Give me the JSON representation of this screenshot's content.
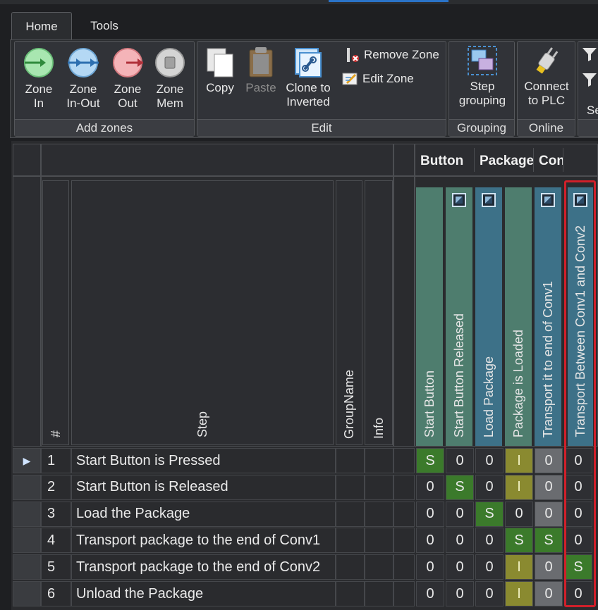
{
  "tabs": [
    {
      "label": "Home",
      "active": true
    },
    {
      "label": "Tools",
      "active": false
    }
  ],
  "ribbon": {
    "groups": [
      {
        "title": "Add zones",
        "buttons": [
          {
            "label": "Zone\nIn",
            "icon": "zone-in-icon"
          },
          {
            "label": "Zone\nIn-Out",
            "icon": "zone-in-out-icon"
          },
          {
            "label": "Zone\nOut",
            "icon": "zone-out-icon"
          },
          {
            "label": "Zone\nMem",
            "icon": "zone-mem-icon"
          }
        ]
      },
      {
        "title": "Edit",
        "buttons": [
          {
            "label": "Copy",
            "icon": "copy-icon"
          },
          {
            "label": "Paste",
            "icon": "paste-icon",
            "disabled": true
          },
          {
            "label": "Clone to\nInverted",
            "icon": "clone-icon"
          },
          {
            "label": "Remove Zone",
            "icon": "remove-zone-icon"
          },
          {
            "label": "Edit Zone",
            "icon": "edit-zone-icon"
          }
        ]
      },
      {
        "title": "Grouping",
        "buttons": [
          {
            "label": "Step\ngrouping",
            "icon": "step-grouping-icon"
          }
        ]
      },
      {
        "title": "Online",
        "buttons": [
          {
            "label": "Connect\nto PLC",
            "icon": "plug-icon"
          }
        ]
      },
      {
        "title": "",
        "buttons": [
          {
            "label": "Se",
            "icon": "filter-icon"
          }
        ]
      }
    ]
  },
  "grid": {
    "fixed_headers": {
      "number": "#",
      "step": "Step",
      "group": "GroupName",
      "info": "Info"
    },
    "column_groups": [
      "Button",
      "Package",
      "Con"
    ],
    "columns": [
      {
        "label": "Start Button",
        "color": "#4e7d6e",
        "icon": false
      },
      {
        "label": "Start Button Released",
        "color": "#4e7d6e",
        "icon": true
      },
      {
        "label": "Load Package",
        "color": "#3d7188",
        "icon": true
      },
      {
        "label": "Package is Loaded",
        "color": "#4e7d6e",
        "icon": false
      },
      {
        "label": "Transport it to end of Conv1",
        "color": "#3d7188",
        "icon": true
      },
      {
        "label": "Transport Between Conv1 and Conv2",
        "color": "#3d7188",
        "icon": true
      }
    ],
    "rows": [
      {
        "num": "1",
        "step": "Start Button is Pressed",
        "current": true,
        "values": [
          "S",
          "0",
          "0",
          "I",
          "0",
          "0"
        ]
      },
      {
        "num": "2",
        "step": "Start Button is Released",
        "current": false,
        "values": [
          "0",
          "S",
          "0",
          "I",
          "0",
          "0"
        ]
      },
      {
        "num": "3",
        "step": "Load the Package",
        "current": false,
        "values": [
          "0",
          "0",
          "S",
          "0",
          "0",
          "0"
        ]
      },
      {
        "num": "4",
        "step": "Transport package to the end of Conv1",
        "current": false,
        "values": [
          "0",
          "0",
          "0",
          "S",
          "S",
          "0"
        ]
      },
      {
        "num": "5",
        "step": "Transport package to the end of Conv2",
        "current": false,
        "values": [
          "0",
          "0",
          "0",
          "I",
          "0",
          "S"
        ]
      },
      {
        "num": "6",
        "step": "Unload the Package",
        "current": false,
        "values": [
          "0",
          "0",
          "0",
          "I",
          "0",
          "0"
        ]
      }
    ]
  },
  "colors": {
    "highlight": "#d0202a",
    "state_s": "#3b7a2b",
    "state_i": "#8a8a30"
  }
}
